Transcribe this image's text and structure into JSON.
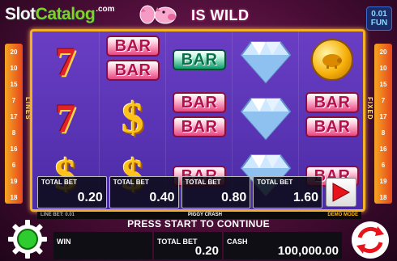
{
  "header": {
    "logo_part1": "Slot",
    "logo_part2": "Catalog",
    "logo_suffix": ".com",
    "wild_text": "IS WILD",
    "fun_value": "0.01",
    "fun_label": "FUN"
  },
  "side_left": [
    "20",
    "10",
    "15",
    "7",
    "17",
    "8",
    "16",
    "6",
    "19",
    "18"
  ],
  "side_right": [
    "20",
    "10",
    "15",
    "7",
    "17",
    "8",
    "16",
    "6",
    "19",
    "18"
  ],
  "labels": {
    "lines": "LINES",
    "fixed": "FIXED"
  },
  "reels": [
    [
      "seven",
      "seven",
      "dollar"
    ],
    [
      "bar-double",
      "dollar",
      "dollar"
    ],
    [
      "bar-green",
      "bar-double",
      "bar"
    ],
    [
      "diamond",
      "diamond",
      "diamond"
    ],
    [
      "coin",
      "bar-double",
      "bar"
    ]
  ],
  "symbol_text": {
    "bar": "BAR"
  },
  "bet_options": [
    {
      "label": "TOTAL BET",
      "value": "0.20"
    },
    {
      "label": "TOTAL BET",
      "value": "0.40"
    },
    {
      "label": "TOTAL BET",
      "value": "0.80"
    },
    {
      "label": "TOTAL BET",
      "value": "1.60"
    }
  ],
  "info_strip": {
    "line_bet": "LINE BET: 0.01",
    "game_name": "PIGGY CRASH",
    "mode": "DEMO MODE"
  },
  "message": "PRESS START TO CONTINUE",
  "bottom": {
    "win_label": "WIN",
    "win_value": "",
    "total_bet_label": "TOTAL BET",
    "total_bet_value": "0.20",
    "cash_label": "CASH",
    "cash_value": "100,000.00"
  },
  "colors": {
    "frame_gold": "#f3b12a",
    "reel_bg": "#5a34b8",
    "bar_pink": "#e8437f",
    "bar_green": "#0d9c6c",
    "play_red": "#e8141c"
  }
}
